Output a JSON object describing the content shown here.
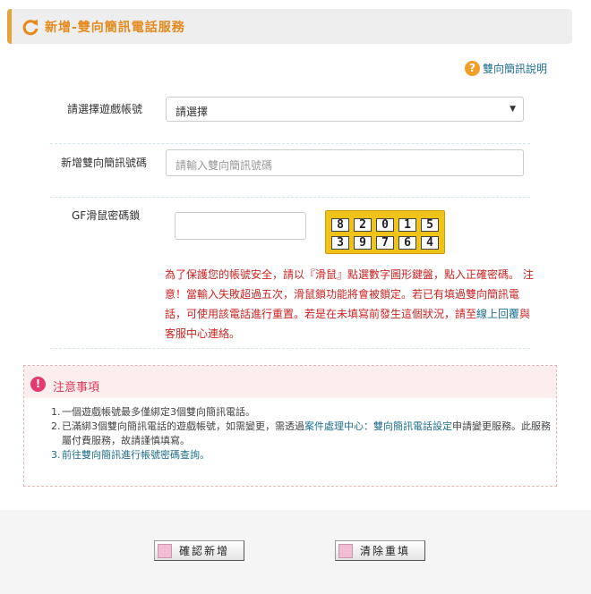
{
  "header": {
    "title": "新增-雙向簡訊電話服務",
    "icon": "refresh-icon"
  },
  "help": {
    "icon": "question-icon",
    "label": "雙向簡訊說明"
  },
  "form": {
    "account_label": "請選擇遊戲帳號",
    "account_select_value": "請選擇",
    "phone_label": "新增雙向簡訊號碼",
    "phone_placeholder": "請輸入雙向簡訊號碼",
    "mouse_lock_label": "GF滑鼠密碼鎖",
    "password_value": ""
  },
  "keypad": {
    "row1": [
      "8",
      "2",
      "0",
      "1",
      "5"
    ],
    "row2": [
      "3",
      "9",
      "7",
      "6",
      "4"
    ]
  },
  "warning": {
    "part1": "為了保護您的帳號安全，請以『滑鼠』點選數字圖形鍵盤，點入正確密碼。 注意！當輸入失敗超過五次，滑鼠鎖功能將會被鎖定。若已有填過雙向簡訊電話，可使用該電話進行重置。若是在未填寫前發生這個狀況，請至",
    "link": "線上回覆",
    "part2": "與客服中心連絡。"
  },
  "notice": {
    "icon": "exclamation-icon",
    "title": "注意事項",
    "item1_num": "1.",
    "item1": "一個遊戲帳號最多僅綁定3個雙向簡訊電話。",
    "item2_num": "2.",
    "item2_pre": "已滿綁3個雙向簡訊電話的遊戲帳號，如需變更，需透過",
    "item2_link": "案件處理中心：雙向簡訊電話設定",
    "item2_post": "申請變更服務。此服務屬付費服務，故請謹慎填寫。",
    "item3_num": "3.",
    "item3": "前往雙向簡訊進行帳號密碼查詢。"
  },
  "buttons": {
    "confirm": "確認新增",
    "clear": "清除重填"
  },
  "colors": {
    "accent": "#e48a1c",
    "link": "#1e6e8c",
    "warning": "#cc2222",
    "notice_title": "#d83a5a",
    "keypad_bg": "#f0c318",
    "button_square": "#f2bcd2"
  }
}
